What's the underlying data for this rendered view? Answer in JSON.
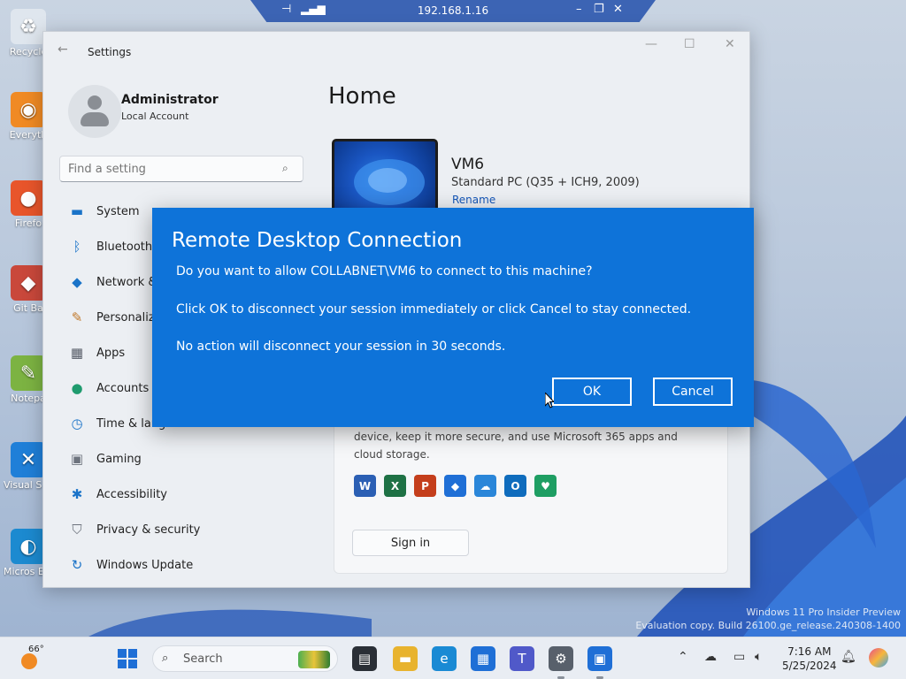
{
  "rdp_bar": {
    "host": "192.168.1.16",
    "pin_icon": "pin-icon",
    "signal_icon": "signal-bars-icon"
  },
  "desktop": {
    "icons": [
      {
        "label": "Recycle",
        "icon": "recycle-bin-icon",
        "color": "#dfe6ee"
      },
      {
        "label": "Everyth",
        "icon": "everything-search-icon",
        "color": "#f08a24"
      },
      {
        "label": "Firefo",
        "icon": "firefox-icon",
        "color": "#e8552b"
      },
      {
        "label": "Git Ba",
        "icon": "git-bash-icon",
        "color": "#c9483b"
      },
      {
        "label": "Notepa",
        "icon": "notepad-icon",
        "color": "#7cb342"
      },
      {
        "label": "Visual S Cod",
        "icon": "vscode-icon",
        "color": "#1f7fd8"
      },
      {
        "label": "Micros Edge",
        "icon": "edge-icon",
        "color": "#1c8ad0"
      }
    ],
    "watermark_line1": "Windows 11 Pro Insider Preview",
    "watermark_line2": "Evaluation copy. Build 26100.ge_release.240308-1400"
  },
  "settings": {
    "title": "Settings",
    "profile": {
      "name": "Administrator",
      "subtitle": "Local Account"
    },
    "search_placeholder": "Find a setting",
    "nav": [
      {
        "label": "System",
        "icon": "monitor-icon",
        "color": "#1a73c8"
      },
      {
        "label": "Bluetooth",
        "icon": "bluetooth-icon",
        "color": "#1a73c8"
      },
      {
        "label": "Network &",
        "icon": "wifi-icon",
        "color": "#1a73c8"
      },
      {
        "label": "Personaliz",
        "icon": "brush-icon",
        "color": "#c0782a"
      },
      {
        "label": "Apps",
        "icon": "apps-icon",
        "color": "#555b66"
      },
      {
        "label": "Accounts",
        "icon": "person-icon",
        "color": "#1f9b6e"
      },
      {
        "label": "Time & lang",
        "icon": "clock-globe-icon",
        "color": "#1a73c8"
      },
      {
        "label": "Gaming",
        "icon": "gamepad-icon",
        "color": "#6d737d"
      },
      {
        "label": "Accessibility",
        "icon": "accessibility-icon",
        "color": "#1a73c8"
      },
      {
        "label": "Privacy & security",
        "icon": "shield-icon",
        "color": "#6d737d"
      },
      {
        "label": "Windows Update",
        "icon": "update-icon",
        "color": "#1a73c8"
      }
    ],
    "home_title": "Home",
    "device": {
      "name": "VM6",
      "model": "Standard PC (Q35 + ICH9, 2009)",
      "rename": "Rename"
    },
    "card": {
      "text": "device, keep it more secure, and use Microsoft 365 apps and cloud storage.",
      "sign_in": "Sign in",
      "apps": [
        {
          "icon": "word-icon",
          "glyph": "W",
          "color": "#2b5fb4"
        },
        {
          "icon": "excel-icon",
          "glyph": "X",
          "color": "#1e7145"
        },
        {
          "icon": "powerpoint-icon",
          "glyph": "P",
          "color": "#c43e1c"
        },
        {
          "icon": "defender-icon",
          "glyph": "◆",
          "color": "#1f6fd6"
        },
        {
          "icon": "onedrive-icon",
          "glyph": "☁",
          "color": "#2a86d9"
        },
        {
          "icon": "outlook-icon",
          "glyph": "O",
          "color": "#0f6cbd"
        },
        {
          "icon": "family-icon",
          "glyph": "♥",
          "color": "#1e9e63"
        }
      ]
    }
  },
  "dialog": {
    "title": "Remote Desktop Connection",
    "line1": "Do you want to allow COLLABNET\\VM6 to connect to this machine?",
    "line2": "Click OK to disconnect your session immediately or click Cancel to stay connected.",
    "line3": "No action will disconnect your session in 30 seconds.",
    "ok": "OK",
    "cancel": "Cancel"
  },
  "taskbar": {
    "temperature": "66°",
    "search": "Search",
    "time": "7:16 AM",
    "date": "5/25/2024",
    "apps": [
      {
        "icon": "task-view-icon",
        "color": "#2a2f36",
        "glyph": "▤"
      },
      {
        "icon": "file-explorer-icon",
        "color": "#e8b32e",
        "glyph": "▬"
      },
      {
        "icon": "edge-icon",
        "color": "#1a8ad4",
        "glyph": "e"
      },
      {
        "icon": "store-icon",
        "color": "#1f6fd6",
        "glyph": "▦"
      },
      {
        "icon": "teams-icon",
        "color": "#5059c9",
        "glyph": "T"
      },
      {
        "icon": "settings-gear-icon",
        "color": "#58606b",
        "glyph": "⚙"
      },
      {
        "icon": "remote-desktop-icon",
        "color": "#1f6fd6",
        "glyph": "▣"
      }
    ]
  }
}
